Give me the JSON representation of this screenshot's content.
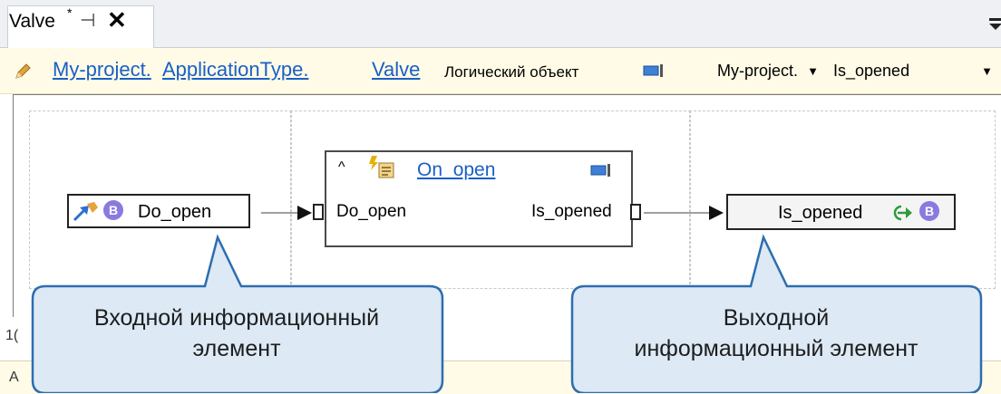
{
  "tab": {
    "title": "Valve",
    "modified_mark": "*",
    "pin_glyph": "⊣",
    "close_glyph": "✕"
  },
  "breadcrumb": {
    "project": "My-project.",
    "application_type": "ApplicationType.",
    "object": "Valve",
    "type_label": "Логический объект",
    "combo_project": "My-project.",
    "combo_variable": "Is_opened"
  },
  "diagram": {
    "input_element": {
      "label": "Do_open",
      "badge": "B"
    },
    "block": {
      "title": "On_open",
      "input_pin": "Do_open",
      "output_pin": "Is_opened",
      "collapse_glyph": "^"
    },
    "output_element": {
      "label": "Is_opened",
      "badge": "B"
    }
  },
  "callouts": {
    "input": {
      "line1": "Входной информационный",
      "line2": "элемент"
    },
    "output": {
      "line1": "Выходной",
      "line2": "информационный элемент"
    }
  },
  "bottom": {
    "fragment": "1(",
    "fragment2": "A"
  },
  "colors": {
    "link": "#1a5fc6",
    "callout_fill": "#dde9f5",
    "callout_border": "#2d6eb0",
    "crumb_bg": "#fffbe6",
    "badge": "#8a7ae0"
  }
}
